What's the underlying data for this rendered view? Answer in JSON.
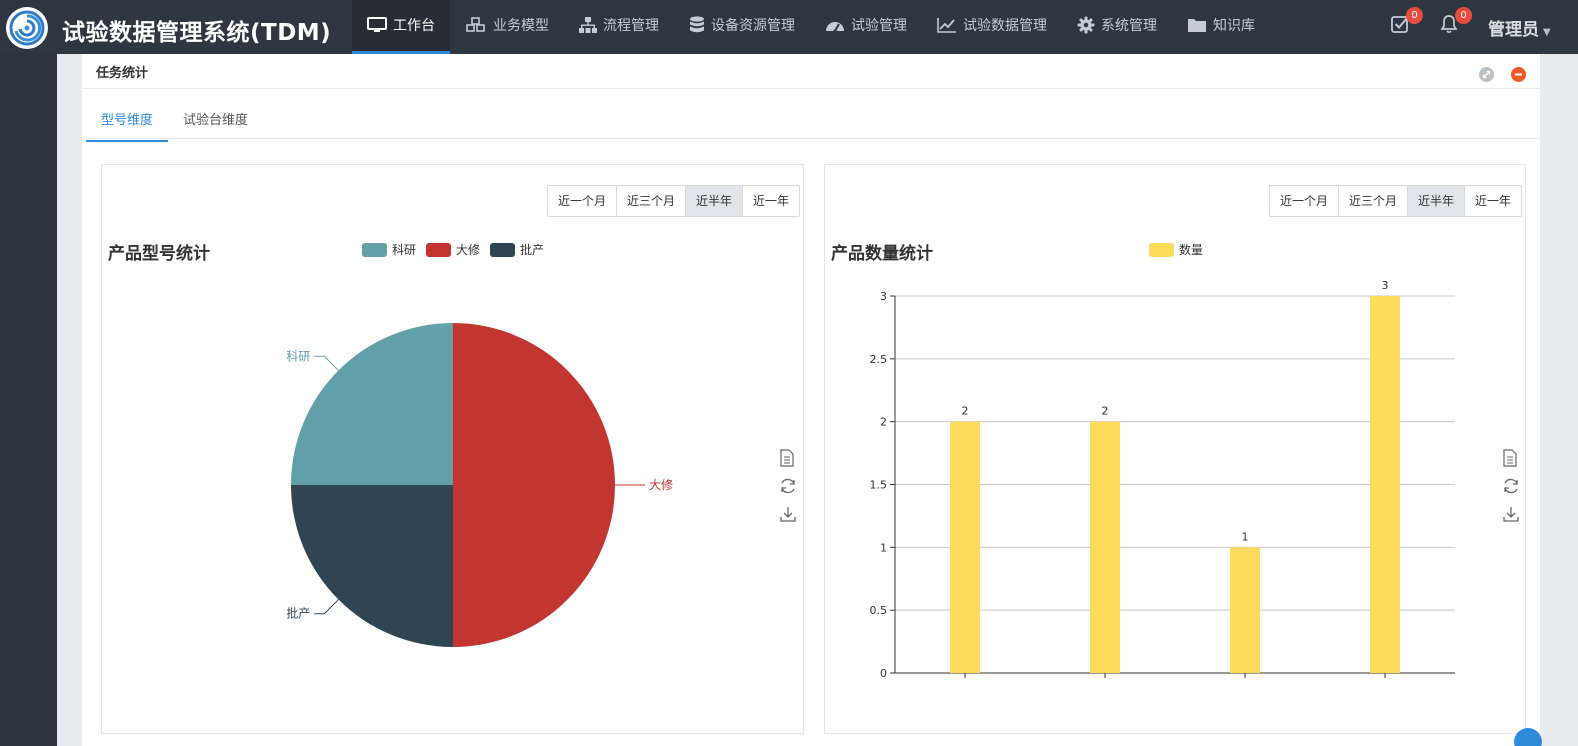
{
  "app": {
    "title": "试验数据管理系统(TDM)"
  },
  "nav": [
    {
      "label": "工作台",
      "icon": "monitor-icon",
      "active": true
    },
    {
      "label": "业务模型",
      "icon": "cubes-icon"
    },
    {
      "label": "流程管理",
      "icon": "sitemap-icon"
    },
    {
      "label": "设备资源管理",
      "icon": "database-icon"
    },
    {
      "label": "试验管理",
      "icon": "dashboard-icon"
    },
    {
      "label": "试验数据管理",
      "icon": "line-chart-icon"
    },
    {
      "label": "系统管理",
      "icon": "gear-icon"
    },
    {
      "label": "知识库",
      "icon": "folder-icon"
    }
  ],
  "header": {
    "tasks_badge": "0",
    "notifications_badge": "0",
    "user": "管理员"
  },
  "panel": {
    "title": "任务统计",
    "tabs": [
      {
        "label": "型号维度",
        "active": true
      },
      {
        "label": "试验台维度"
      }
    ]
  },
  "ranges": [
    "近一个月",
    "近三个月",
    "近半年",
    "近一年"
  ],
  "active_range": "近半年",
  "colors": {
    "accent": "#2e8bd9",
    "keyan": "#61a0a8",
    "daxiu": "#c23531",
    "pichan": "#2f4554",
    "bar": "#ffdb5c"
  },
  "chart_data": [
    {
      "type": "pie",
      "title": "产品型号统计",
      "legend": [
        "科研",
        "大修",
        "批产"
      ],
      "slices": [
        {
          "name": "大修",
          "value": 2
        },
        {
          "name": "批产",
          "value": 1
        },
        {
          "name": "科研",
          "value": 1
        }
      ]
    },
    {
      "type": "bar",
      "title": "产品数量统计",
      "legend": [
        "数量"
      ],
      "categories": [
        "",
        "",
        "",
        ""
      ],
      "series": [
        {
          "name": "数量",
          "values": [
            2,
            2,
            1,
            3
          ]
        }
      ],
      "ylim": [
        0,
        3
      ],
      "yticks": [
        "0",
        "0.5",
        "1",
        "1.5",
        "2",
        "2.5",
        "3"
      ],
      "data_labels": [
        "2",
        "2",
        "1",
        "3"
      ],
      "grid": true
    }
  ]
}
